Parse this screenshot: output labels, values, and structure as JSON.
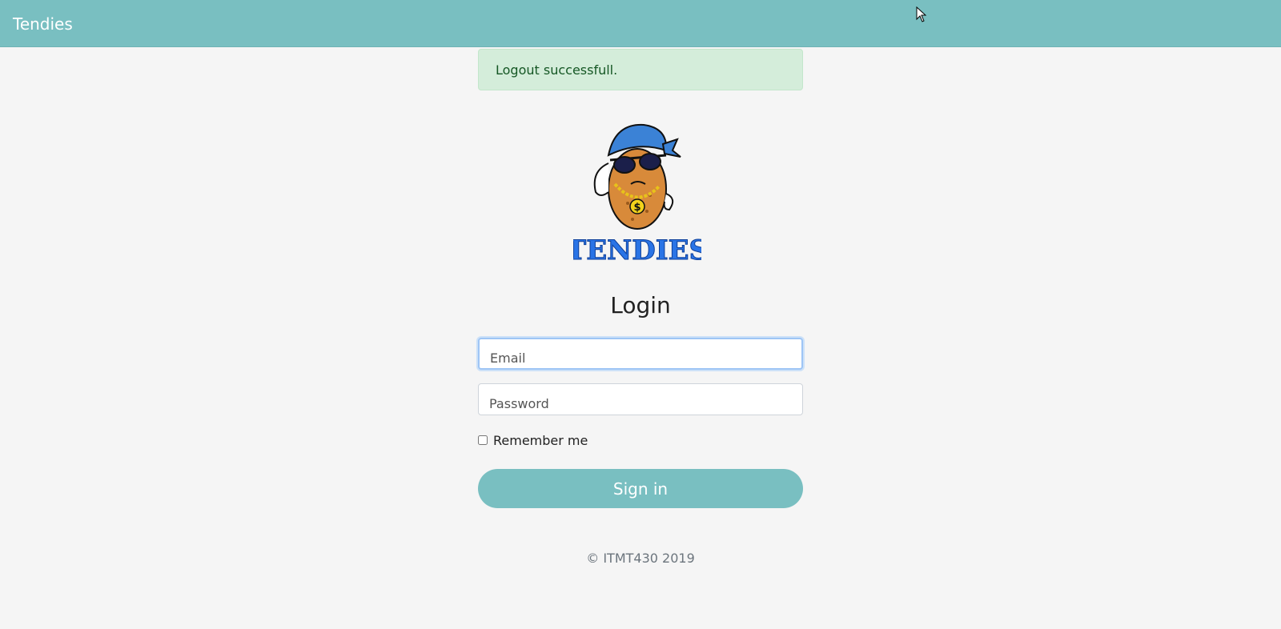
{
  "navbar": {
    "brand": "Tendies"
  },
  "alert": {
    "message": "Logout successfull."
  },
  "logo": {
    "wordmark": "TENDIES"
  },
  "login": {
    "title": "Login",
    "email_placeholder": "Email",
    "password_placeholder": "Password",
    "remember_label": "Remember me",
    "submit_label": "Sign in"
  },
  "footer": {
    "text": "© ITMT430 2019"
  },
  "colors": {
    "primary": "#79bfc1",
    "alert_bg": "#d4edda",
    "alert_text": "#155724",
    "background": "#f5f5f5"
  }
}
